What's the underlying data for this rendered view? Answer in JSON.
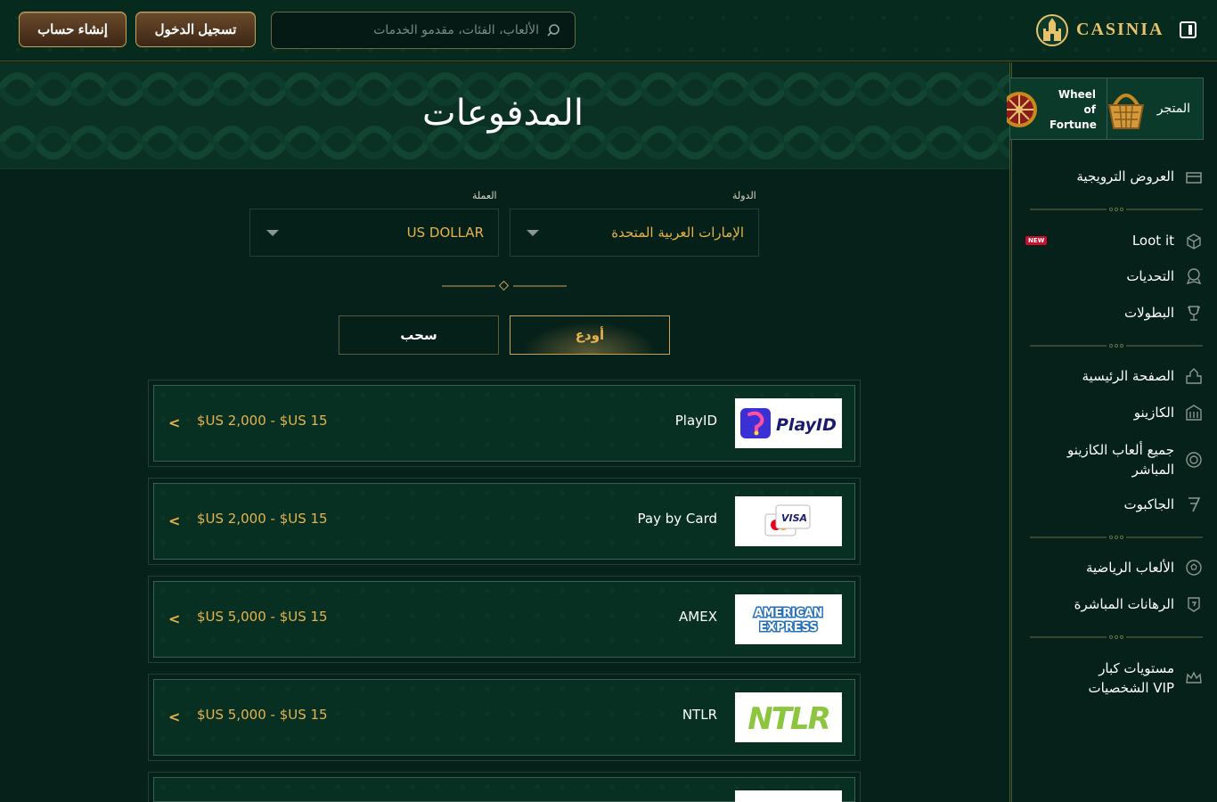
{
  "header": {
    "register_label": "إنشاء حساب",
    "login_label": "تسجيل الدخول",
    "search_placeholder": "الألعاب، الفئات، مقدمو الخدمات",
    "brand": "CASINIA"
  },
  "page": {
    "title": "المدفوعات",
    "country_label": "الدولة",
    "country_value": "الإمارات العربية المتحدة",
    "currency_label": "العملة",
    "currency_value": "US DOLLAR",
    "tab_deposit": "أودع",
    "tab_withdraw": "سحب"
  },
  "payments": [
    {
      "name": "PlayID",
      "range": "$US 2,000 - $US 15",
      "logo": "PlayID"
    },
    {
      "name": "Pay by Card",
      "range": "$US 2,000 - $US 15",
      "logo": "VISA"
    },
    {
      "name": "AMEX",
      "range": "$US 5,000 - $US 15",
      "logo": "AMERICAN EXPRESS"
    },
    {
      "name": "NTLR",
      "range": "$US 5,000 - $US 15",
      "logo": "NTLR"
    }
  ],
  "sidebar": {
    "promo_wheel": "Wheel of Fortune",
    "promo_shop": "المتجر",
    "items": [
      {
        "label": "العروض الترويجية",
        "icon": "gift-box-icon"
      },
      {
        "label": "Loot it",
        "icon": "loot-box-icon",
        "badge": "NEW"
      },
      {
        "label": "التحديات",
        "icon": "challenge-icon"
      },
      {
        "label": "البطولات",
        "icon": "trophy-icon"
      },
      {
        "label": "الصفحة الرئيسية",
        "icon": "home-castle-icon"
      },
      {
        "label": "الكازينو",
        "icon": "casino-building-icon"
      },
      {
        "label": "جميع ألعاب الكازينو المباشر",
        "icon": "live-chip-icon"
      },
      {
        "label": "الجاكبوت",
        "icon": "jackpot-seven-icon"
      },
      {
        "label": "الألعاب الرياضية",
        "icon": "soccer-ball-icon"
      },
      {
        "label": "الرهانات المباشرة",
        "icon": "live-bet-icon"
      },
      {
        "label": "مستويات كبار الشخصيات VIP",
        "icon": "crown-icon"
      }
    ]
  },
  "colors": {
    "accent": "#e6b34d",
    "background": "#062119",
    "panel": "#073023"
  }
}
